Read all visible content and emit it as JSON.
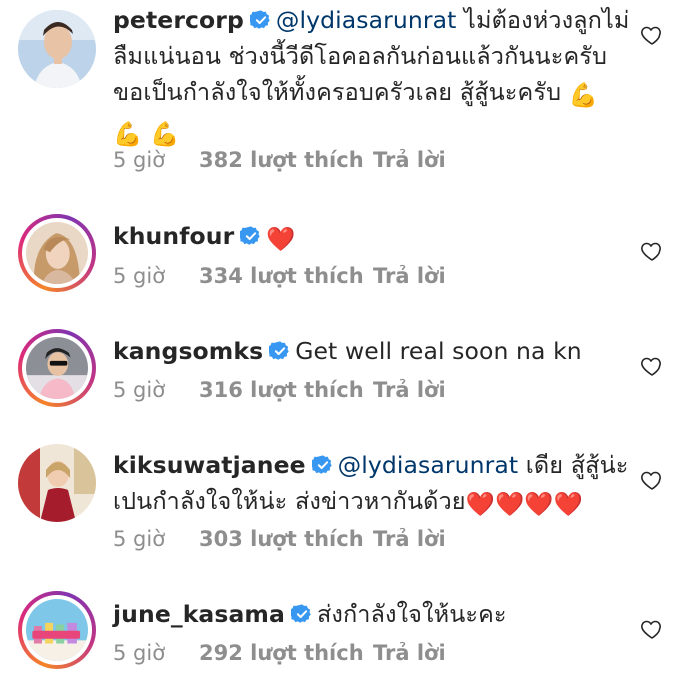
{
  "comments": [
    {
      "username": "petercorp",
      "verified": true,
      "mention": "@lydiasarunrat",
      "text_line1": " ไม่ต้องห่วงลูกไม่",
      "text_line2": "ลืมแน่นอน ช่วงนี้วีดีโอคอลกันก่อนแล้วกันนะครับ",
      "text_line3": "ขอเป็นกำลังใจให้ทั้งครอบครัวเลย สู้สู้นะครับ ",
      "emoji": "💪",
      "time": "5 giờ",
      "likes": "382 lượt thích",
      "reply": "Trả lời"
    },
    {
      "username": "khunfour",
      "verified": true,
      "text": "",
      "emoji": "❤️",
      "time": "5 giờ",
      "likes": "334 lượt thích",
      "reply": "Trả lời"
    },
    {
      "username": "kangsomks",
      "verified": true,
      "text": "Get well real soon na kn",
      "time": "5 giờ",
      "likes": "316 lượt thích",
      "reply": "Trả lời"
    },
    {
      "username": "kiksuwatjanee",
      "verified": true,
      "mention": "@lydiasarunrat",
      "text_line1": " เดีย สู้สู้น่ะ",
      "text_line2": "เปนกำลังใจให้น่ะ ส่งข่าวหากันด้วย",
      "emoji": "❤️",
      "time": "5 giờ",
      "likes": "303 lượt thích",
      "reply": "Trả lời"
    },
    {
      "username": "june_kasama",
      "verified": true,
      "text": "ส่งกำลังใจให้นะคะ",
      "time": "5 giờ",
      "likes": "292 lượt thích",
      "reply": "Trả lời"
    }
  ],
  "icons": {
    "verified": "verified-badge-icon",
    "like": "heart-outline-icon"
  },
  "colors": {
    "verified": "#3897f0",
    "mention": "#00376b",
    "meta": "#8e8e8e",
    "text": "#262626"
  }
}
